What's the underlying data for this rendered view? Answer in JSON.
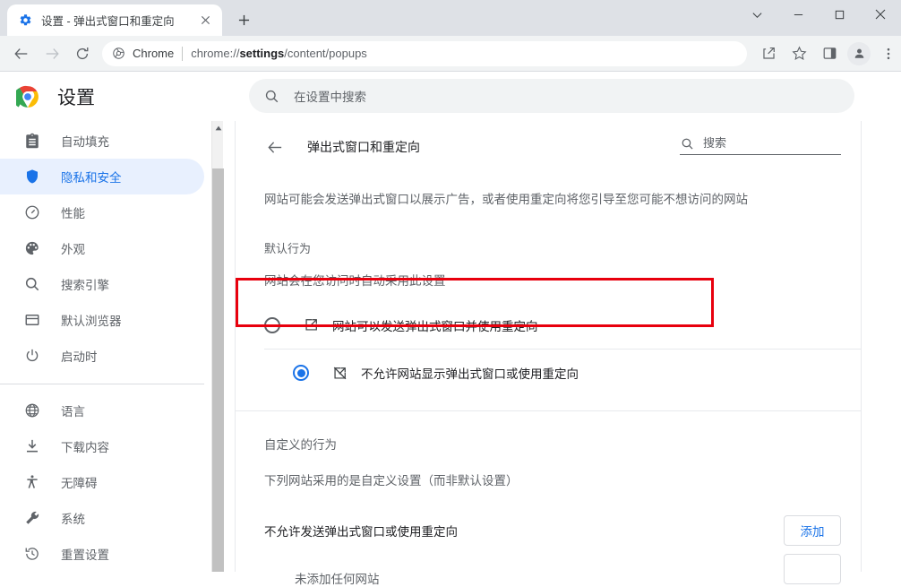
{
  "window": {
    "controls": [
      {
        "name": "chevron-down-icon",
        "label": "∨"
      },
      {
        "name": "minimize-icon",
        "label": "—"
      },
      {
        "name": "maximize-icon",
        "label": "□"
      },
      {
        "name": "close-icon",
        "label": "✕"
      }
    ]
  },
  "tabs": {
    "active": {
      "title": "设置 - 弹出式窗口和重定向",
      "favicon": "gear-icon",
      "close_label": "✕"
    },
    "new_tab_label": "+"
  },
  "toolbar": {
    "back_icon": "back-arrow-icon",
    "forward_icon": "forward-arrow-icon",
    "reload_icon": "reload-icon",
    "omnibox": {
      "chip": "Chrome",
      "url_prefix": "chrome://",
      "url_bold": "settings",
      "url_suffix": "/content/popups"
    },
    "share_icon": "share-icon",
    "bookmark_icon": "star-icon",
    "sidepanel_icon": "side-panel-icon",
    "profile_icon": "profile-avatar-icon",
    "menu_icon": "three-dots-menu-icon"
  },
  "settings_header": {
    "logo": "chrome-logo",
    "title": "设置",
    "search_placeholder": "在设置中搜索",
    "search_icon": "search-icon"
  },
  "sidebar": {
    "items": [
      {
        "label": "自动填充",
        "icon": "clipboard-icon",
        "active": false
      },
      {
        "label": "隐私和安全",
        "icon": "shield-icon",
        "active": true
      },
      {
        "label": "性能",
        "icon": "speedometer-icon",
        "active": false
      },
      {
        "label": "外观",
        "icon": "palette-icon",
        "active": false
      },
      {
        "label": "搜索引擎",
        "icon": "search-icon",
        "active": false
      },
      {
        "label": "默认浏览器",
        "icon": "browser-window-icon",
        "active": false
      },
      {
        "label": "启动时",
        "icon": "power-icon",
        "active": false
      }
    ],
    "items_lower": [
      {
        "label": "语言",
        "icon": "globe-icon"
      },
      {
        "label": "下载内容",
        "icon": "download-icon"
      },
      {
        "label": "无障碍",
        "icon": "accessibility-icon"
      },
      {
        "label": "系统",
        "icon": "wrench-icon"
      },
      {
        "label": "重置设置",
        "icon": "history-restore-icon"
      }
    ]
  },
  "main": {
    "back_icon": "back-arrow-icon",
    "title": "弹出式窗口和重定向",
    "search_placeholder": "搜索",
    "search_icon": "search-icon",
    "description": "网站可能会发送弹出式窗口以展示广告，或者使用重定向将您引导至您可能不想访问的网站",
    "default_behavior_label": "默认行为",
    "default_behavior_sub": "网站会在您访问时自动采用此设置",
    "radios": [
      {
        "label": "网站可以发送弹出式窗口并使用重定向",
        "icon": "open-in-new-icon",
        "checked": false,
        "highlighted": true
      },
      {
        "label": "不允许网站显示弹出式窗口或使用重定向",
        "icon": "open-in-new-off-icon",
        "checked": true,
        "highlighted": false
      }
    ],
    "custom_behavior_label": "自定义的行为",
    "custom_behavior_sub": "下列网站采用的是自定义设置（而非默认设置）",
    "block_list_label": "不允许发送弹出式窗口或使用重定向",
    "add_button_label": "添加",
    "empty_note": "未添加任何网站"
  },
  "colors": {
    "accent": "#1a73e8",
    "accent_bg": "#e8f0fe",
    "annotation_red": "#e8000d",
    "tabstrip_bg": "#dee1e6",
    "toolbar_bg": "#f1f3f4",
    "text_primary": "#202124",
    "text_secondary": "#5f6368"
  }
}
